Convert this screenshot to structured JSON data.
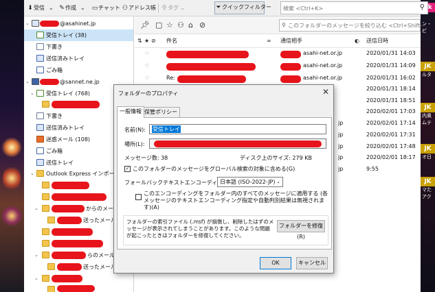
{
  "toolbar": {
    "receive": "受信",
    "compose": "作成",
    "chat": "チャット",
    "address_book": "アドレス帳",
    "tag": "タグ",
    "quick_filter": "クイックフィルター",
    "search_placeholder": "検索 <Ctrl+K>"
  },
  "folders": {
    "account1_suffix": "@asahinet.jp",
    "account1_inbox": "受信トレイ (38)",
    "account1_drafts": "下書き",
    "account1_sent": "送信済みトレイ",
    "account1_trash": "ごみ箱",
    "account2_suffix": "@sannet.ne.jp",
    "account2_inbox": "受信トレイ (768)",
    "account2_drafts": "下書き",
    "account2_sent": "送信済みトレイ",
    "account2_junk": "迷惑メール (108)",
    "account2_trash": "ごみ箱",
    "account2_outbox": "送信トレイ",
    "outlook_import": "Outlook Express インポート",
    "partial_from": "からのメール文字",
    "partial_sent_mail": "送ったメール",
    "partial_from_mail": "らのメール取引",
    "partial_sent_mail2": "送ったメール"
  },
  "message_list": {
    "filter_placeholder": "このフォルダーのメッセージを絞り込む <Ctrl+Shift+K>",
    "col_subject": "件名",
    "col_correspondent": "通信相手",
    "col_date": "送信日時",
    "rows": [
      {
        "subject": "",
        "addr": "asahi-net.or.jp",
        "date": "2020/01/31 14:03"
      },
      {
        "subject": "",
        "addr": "asahi-net.or.jp",
        "date": "2020/01/31 14:09"
      },
      {
        "subject": "Re:",
        "addr": "asahi-net.or.jp",
        "date": "2020/01/31 16:02"
      },
      {
        "subject": "",
        "addr": "",
        "date": "2020/01/31 18:14"
      },
      {
        "subject": "",
        "addr": "",
        "date": "2020/01/31 18:51"
      },
      {
        "subject": "",
        "addr": "",
        "date": "2020/02/01 17:03"
      },
      {
        "subject": "",
        "addr": "jp",
        "date": "2020/02/01 17:14"
      },
      {
        "subject": "",
        "addr": "jp",
        "date": "2020/02/01 17:31"
      },
      {
        "subject": "",
        "addr": "jp",
        "date": "2020/02/01 17:48"
      },
      {
        "subject": "",
        "addr": "jp",
        "date": "2020/02/01 18:17"
      },
      {
        "subject": "",
        "addr": "jp",
        "date": "9:55"
      }
    ]
  },
  "dialog": {
    "title": "フォルダーのプロパティ",
    "tab_general": "一般情報",
    "tab_retention": "保管ポリシー",
    "name_label": "名前(N):",
    "name_value": "受信トレイ",
    "location_label": "場所(L):",
    "message_count": "メッセージ数:  38",
    "disk_size": "ディスク上のサイズ:  279 KB",
    "global_search": "このフォルダーのメッセージをグローバル検索の対象に含める(G)",
    "fallback_label": "フォールバックテキストエンコーディング(E):",
    "encoding_value": "日本語 (ISO-2022-JP)",
    "apply_encoding": "このエンコーディングをフォルダー内のすべてのメッセージに適用する (各メッセージのテキストエンコーディング指定や自動判別結果は無視されます)(A)",
    "repair_text": "フォルダーの索引ファイル (.msf) が損傷し、削除したはずのメッセージが表示されてしまうことがあります。このような問題が起こったときはフォルダーを修復してください。",
    "repair_button": "フォルダーを修復(R)",
    "ok_button": "OK",
    "cancel_button": "キャンセル"
  },
  "background": {
    "right_tags": [
      "dk",
      "JK",
      "JK",
      "JK",
      "JK"
    ],
    "right_text": [
      "ン・ビ",
      "ルタ",
      "内奥",
      "ムテ",
      "オ日",
      "マた",
      "アク"
    ]
  }
}
